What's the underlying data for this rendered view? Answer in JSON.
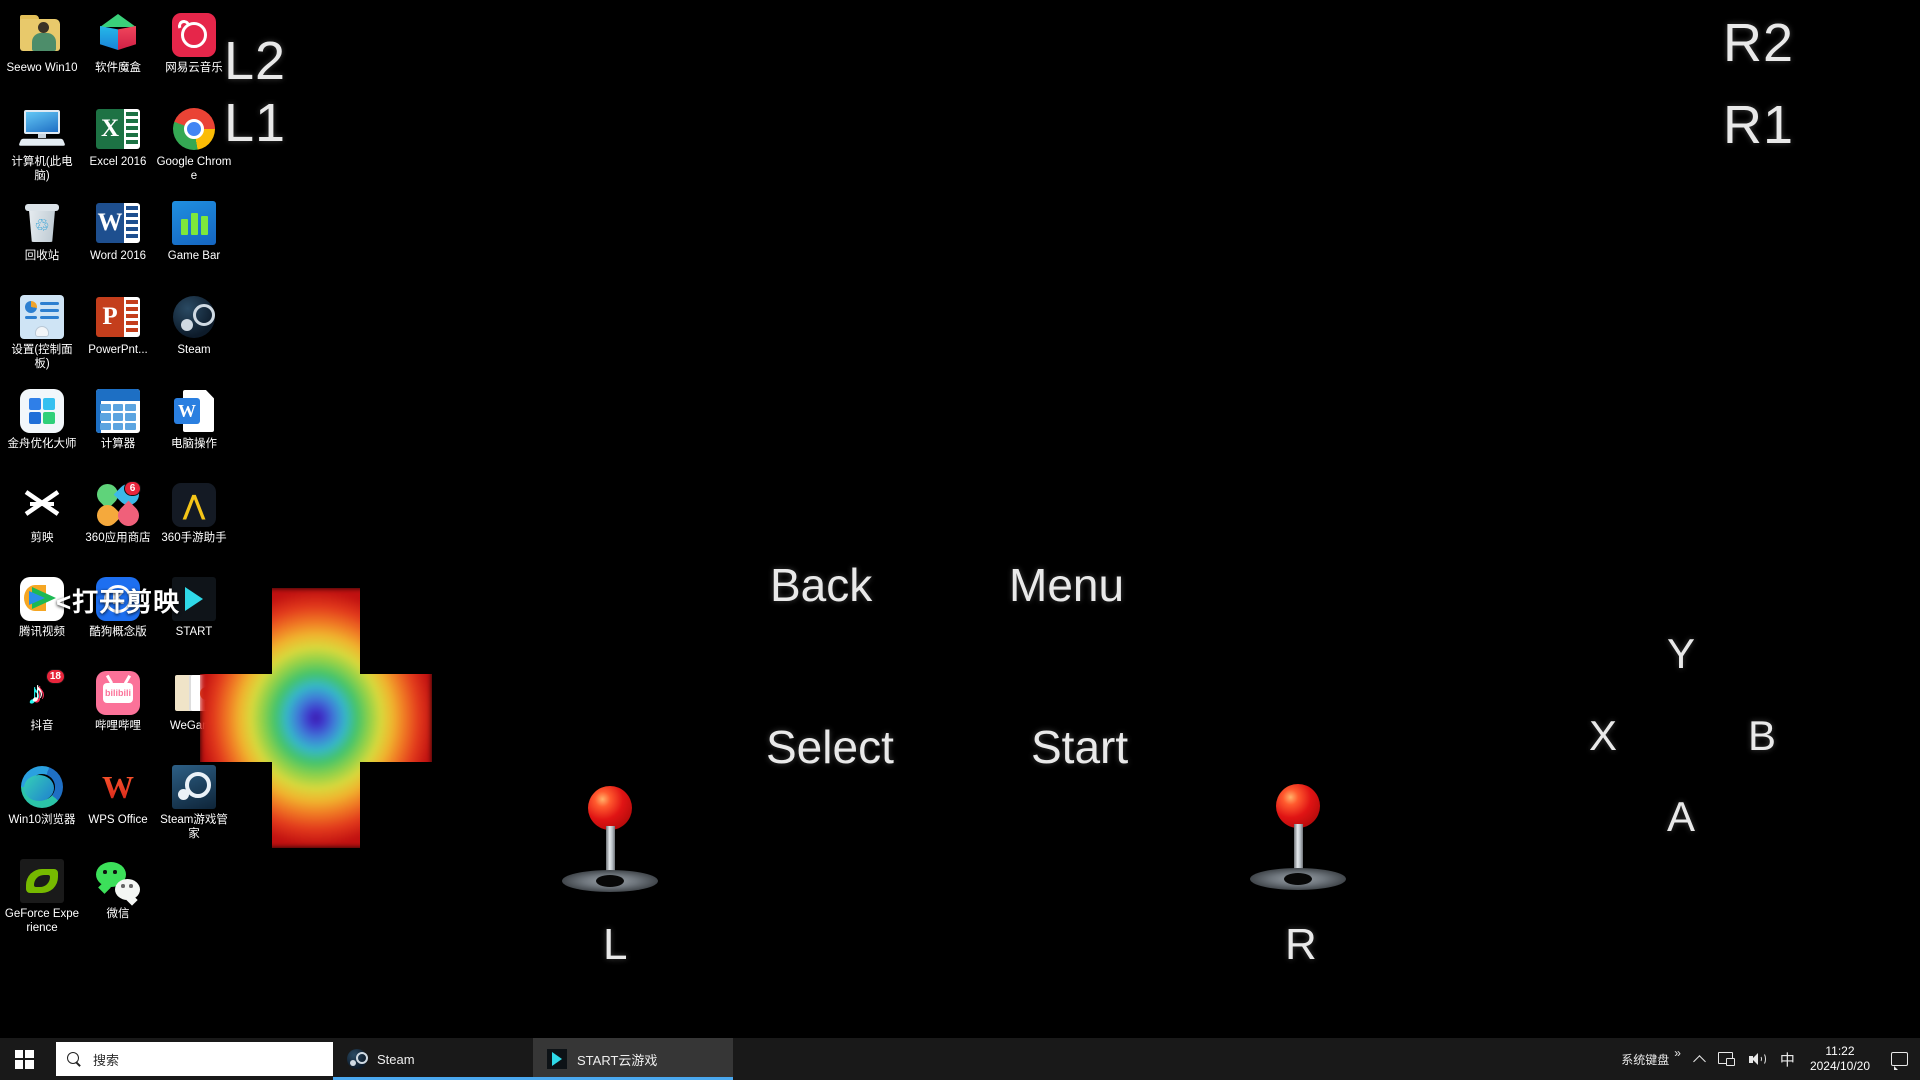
{
  "desktop": {
    "background_color": "#000000",
    "icons": [
      {
        "label": "Seewo Win10",
        "icon": "folder-person-icon"
      },
      {
        "label": "软件魔盒",
        "icon": "cube-icon"
      },
      {
        "label": "网易云音乐",
        "icon": "netease-music-icon"
      },
      {
        "label": "计算机(此电脑)",
        "icon": "this-pc-icon"
      },
      {
        "label": "Excel 2016",
        "icon": "excel-icon"
      },
      {
        "label": "Google Chrome",
        "icon": "chrome-icon"
      },
      {
        "label": "回收站",
        "icon": "recycle-bin-icon"
      },
      {
        "label": "Word 2016",
        "icon": "word-icon"
      },
      {
        "label": "Game Bar",
        "icon": "game-bar-icon"
      },
      {
        "label": "设置(控制面板)",
        "icon": "control-panel-icon"
      },
      {
        "label": "PowerPnt...",
        "icon": "powerpoint-icon"
      },
      {
        "label": "Steam",
        "icon": "steam-icon"
      },
      {
        "label": "金舟优化大师",
        "icon": "jinzhou-optimizer-icon"
      },
      {
        "label": "计算器",
        "icon": "calculator-icon"
      },
      {
        "label": "电脑操作",
        "icon": "wps-doc-icon"
      },
      {
        "label": "剪映",
        "icon": "jianying-icon"
      },
      {
        "label": "360应用商店",
        "icon": "360-app-store-icon",
        "badge": "6"
      },
      {
        "label": "360手游助手",
        "icon": "360-mobile-game-icon"
      },
      {
        "label": "腾讯视频",
        "icon": "tencent-video-icon"
      },
      {
        "label": "酷狗概念版",
        "icon": "kugou-concept-icon"
      },
      {
        "label": "START",
        "icon": "start-cloud-game-icon"
      },
      {
        "label": "抖音",
        "icon": "douyin-icon",
        "badge": "18"
      },
      {
        "label": "哔哩哔哩",
        "icon": "bilibili-icon"
      },
      {
        "label": "WeGame",
        "icon": "wegame-icon"
      },
      {
        "label": "Win10浏览器",
        "icon": "edge-browser-icon"
      },
      {
        "label": "WPS Office",
        "icon": "wps-office-icon"
      },
      {
        "label": "Steam游戏管家",
        "icon": "steam-game-manager-icon"
      },
      {
        "label": "GeForce Experience",
        "icon": "nvidia-geforce-icon"
      },
      {
        "label": "微信",
        "icon": "wechat-icon"
      }
    ],
    "annotation": "<打开剪映"
  },
  "gamepad_overlay": {
    "shoulder_left": [
      "L2",
      "L1"
    ],
    "shoulder_right": [
      "R2",
      "R1"
    ],
    "center_buttons": [
      "Back",
      "Menu",
      "Select",
      "Start"
    ],
    "face_buttons": {
      "top": "Y",
      "left": "X",
      "right": "B",
      "bottom": "A"
    },
    "sticks": [
      {
        "label": "L",
        "ball_color": "#e01414"
      },
      {
        "label": "R",
        "ball_color": "#e01414"
      }
    ],
    "dpad": {
      "name": "dpad-heatmap-cross",
      "gradient_stops": [
        "#3a1fa8",
        "#3f7fd8",
        "#46c46a",
        "#d8d93c",
        "#f07a24",
        "#c01010"
      ]
    },
    "text_color": "#e9e9e9"
  },
  "taskbar": {
    "background_color": "#191919",
    "start_button": "start-button",
    "search": {
      "placeholder": "搜索",
      "icon": "search-icon"
    },
    "items": [
      {
        "label": "Steam",
        "icon": "steam-icon",
        "active": false
      },
      {
        "label": "START云游戏",
        "icon": "start-cloud-game-icon",
        "active": true
      }
    ],
    "tray": {
      "keyboard_label": "系统键盘",
      "overflow": "»",
      "show_hidden_icon": "chevron-up-icon",
      "network_icon": "network-icon",
      "volume_icon": "volume-icon",
      "ime": "中",
      "time": "11:22",
      "date": "2024/10/20",
      "action_center_icon": "notification-icon"
    }
  }
}
